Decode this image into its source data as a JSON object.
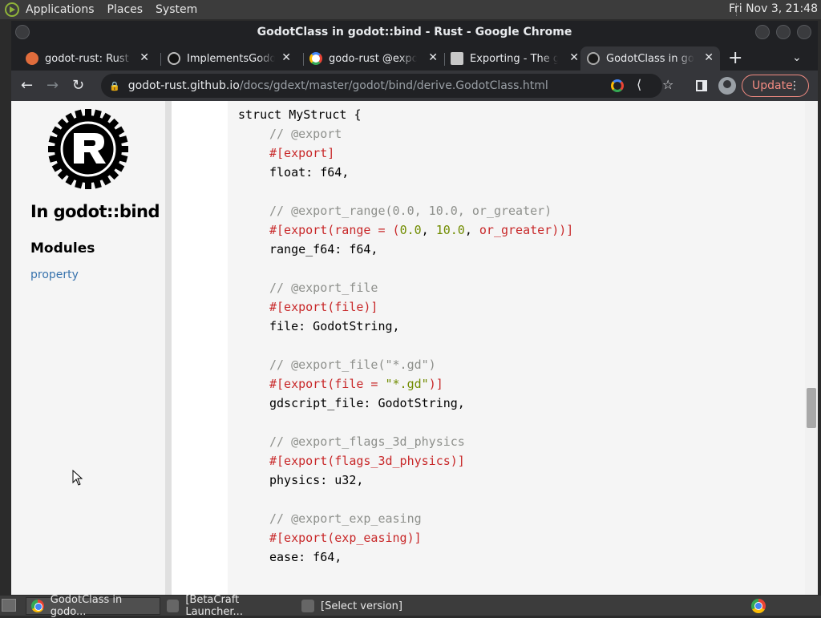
{
  "top_panel": {
    "menus": [
      "Applications",
      "Places",
      "System"
    ],
    "clock": "Fri Nov 3, 21:48"
  },
  "window": {
    "title": "GodotClass in godot::bind - Rust - Google Chrome"
  },
  "tabs": [
    {
      "title": "godot-rust: Rust bi",
      "favicon": "godot-rust-icon",
      "active": false
    },
    {
      "title": "ImplementsGodotE",
      "favicon": "github-icon",
      "active": false
    },
    {
      "title": "godo-rust @export",
      "favicon": "google-icon",
      "active": false
    },
    {
      "title": "Exporting - The gd",
      "favicon": "book-icon",
      "active": false
    },
    {
      "title": "GodotClass in godo",
      "favicon": "rust-icon",
      "active": true
    }
  ],
  "navbar": {
    "url_host": "godot-rust.github.io",
    "url_path": "/docs/gdext/master/godot/bind/derive.GodotClass.html",
    "update_label": "Update"
  },
  "sidebar": {
    "title": "In godot::bind",
    "modules_heading": "Modules",
    "module_link": "property"
  },
  "code": {
    "struct_open": "struct MyStruct {",
    "comments": [
      "// @export",
      "// @export_range(0.0, 10.0, or_greater)",
      "// @export_file",
      "// @export_file(\"*.gd\")",
      "// @export_flags_3d_physics",
      "// @export_exp_easing"
    ],
    "attributes": [
      "#[export]",
      "#[export(range = (",
      "#[export(file)]",
      "#[export(file = ",
      "#[export(flags_3d_physics)]",
      "#[export(exp_easing)]"
    ],
    "range_values": [
      "0.0",
      "10.0",
      "or_greater"
    ],
    "range_close": "))]",
    "file_pattern": "\"*.gd\"",
    "file_close": ")]",
    "fields": [
      "float: f64,",
      "range_f64: f64,",
      "file: GodotString,",
      "gdscript_file: GodotString,",
      "physics: u32,",
      "ease: f64,"
    ]
  },
  "taskbar": {
    "items": [
      "GodotClass in godo...",
      "[BetaCraft Launcher...",
      "[Select version]"
    ]
  }
}
